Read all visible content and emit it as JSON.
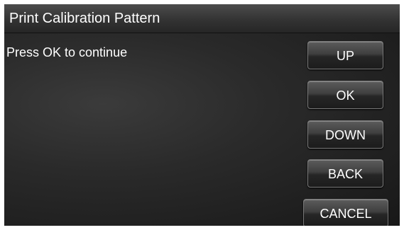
{
  "title": "Print Calibration Pattern",
  "message": "Press OK to continue",
  "buttons": {
    "up": "UP",
    "ok": "OK",
    "down": "DOWN",
    "back": "BACK",
    "cancel": "CANCEL"
  }
}
